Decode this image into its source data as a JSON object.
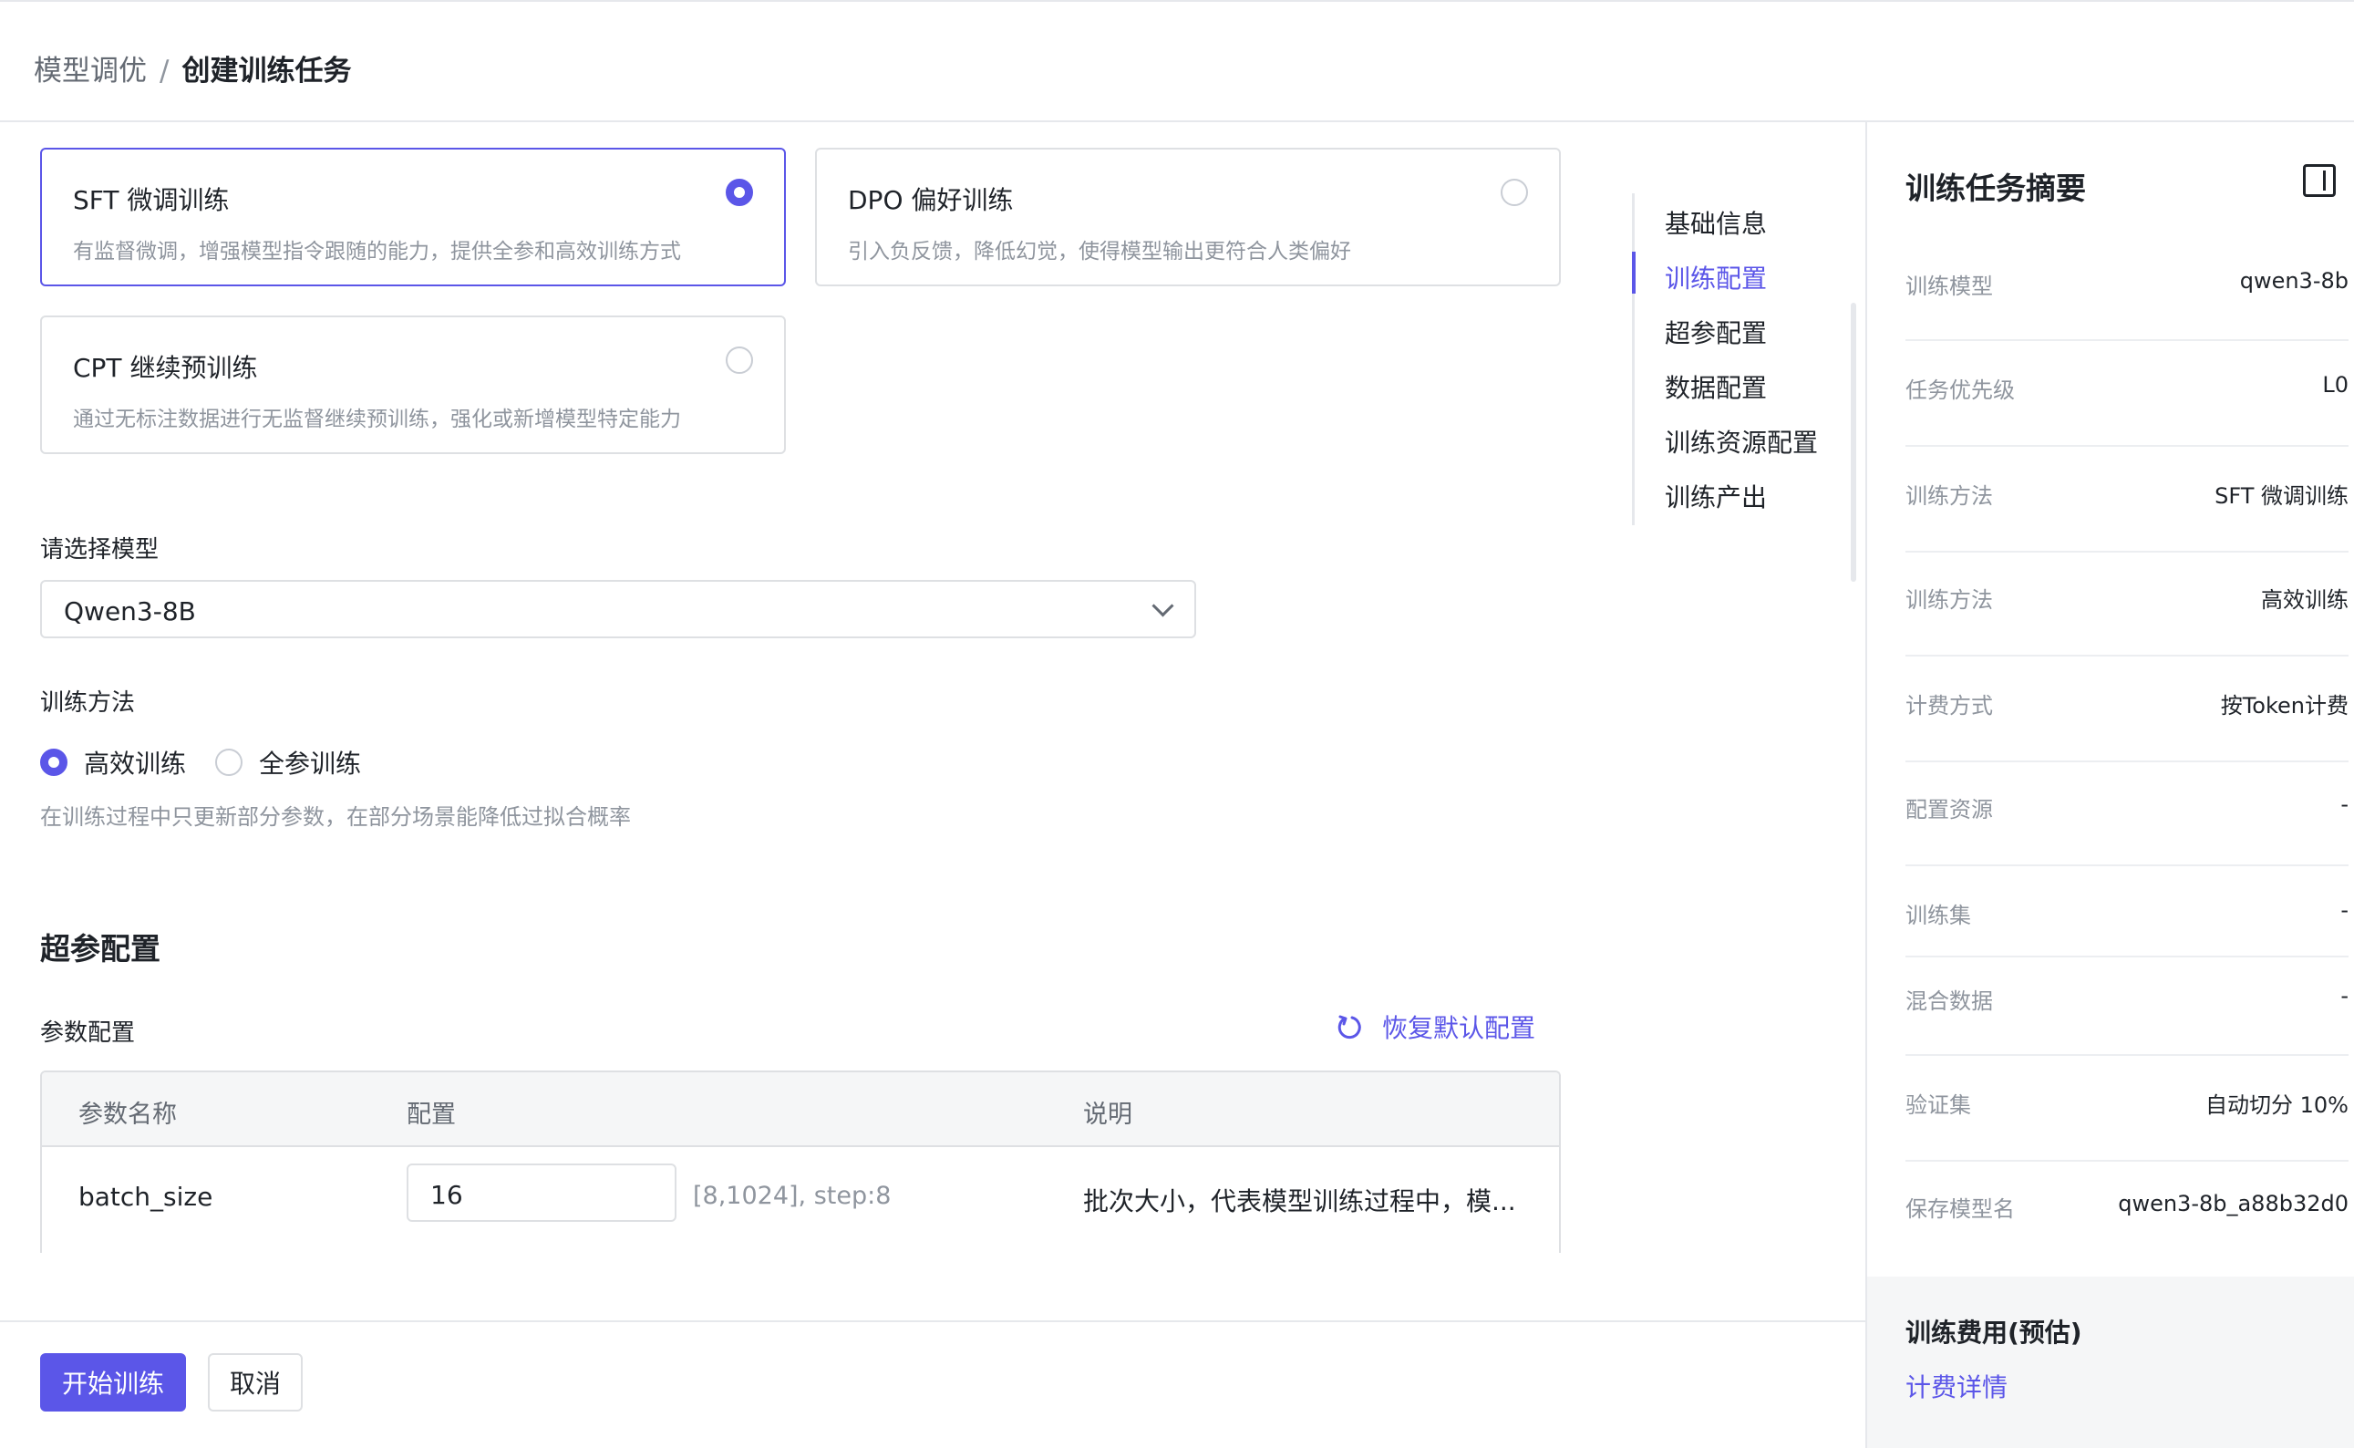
{
  "breadcrumb": {
    "parent": "模型调优",
    "separator": "/",
    "current": "创建训练任务"
  },
  "training_types": [
    {
      "title": "SFT 微调训练",
      "desc": "有监督微调，增强模型指令跟随的能力，提供全参和高效训练方式",
      "selected": true
    },
    {
      "title": "DPO 偏好训练",
      "desc": "引入负反馈，降低幻觉，使得模型输出更符合人类偏好",
      "selected": false
    },
    {
      "title": "CPT 继续预训练",
      "desc": "通过无标注数据进行无监督继续预训练，强化或新增模型特定能力",
      "selected": false
    }
  ],
  "model_select": {
    "label": "请选择模型",
    "value": "Qwen3-8B"
  },
  "method": {
    "label": "训练方法",
    "options": [
      {
        "label": "高效训练",
        "selected": true
      },
      {
        "label": "全参训练",
        "selected": false
      }
    ],
    "hint": "在训练过程中只更新部分参数，在部分场景能降低过拟合概率"
  },
  "hyper": {
    "title": "超参配置",
    "param_label": "参数配置",
    "restore_label": "恢复默认配置",
    "columns": [
      "参数名称",
      "配置",
      "说明"
    ],
    "rows": [
      {
        "name": "batch_size",
        "value": "16",
        "range": "[8,1024], step:8",
        "desc": "批次大小，代表模型训练过程中，模..."
      }
    ]
  },
  "anchor_nav": [
    "基础信息",
    "训练配置",
    "超参配置",
    "数据配置",
    "训练资源配置",
    "训练产出"
  ],
  "anchor_active": "训练配置",
  "footer": {
    "start": "开始训练",
    "cancel": "取消"
  },
  "summary": {
    "title": "训练任务摘要",
    "rows": [
      {
        "k": "训练模型",
        "v": "qwen3-8b"
      },
      {
        "k": "任务优先级",
        "v": "L0"
      },
      {
        "k": "训练方法",
        "v": "SFT 微调训练"
      },
      {
        "k": "训练方法",
        "v": "高效训练"
      },
      {
        "k": "计费方式",
        "v": "按Token计费"
      },
      {
        "k": "配置资源",
        "v": "-"
      },
      {
        "k": "训练集",
        "v": "-"
      },
      {
        "k": "混合数据",
        "v": "-"
      },
      {
        "k": "验证集",
        "v": "自动切分 10%"
      },
      {
        "k": "保存模型名",
        "v": "qwen3-8b_a88b32d0"
      }
    ],
    "cost_title": "训练费用(预估)",
    "cost_link": "计费详情"
  },
  "colors": {
    "accent": "#5b56e8",
    "border": "#dee0e3",
    "muted": "#8f959e"
  },
  "icons": {
    "restore": "refresh-icon",
    "panel": "panel-collapse-icon",
    "dropdown": "chevron-down-icon"
  }
}
